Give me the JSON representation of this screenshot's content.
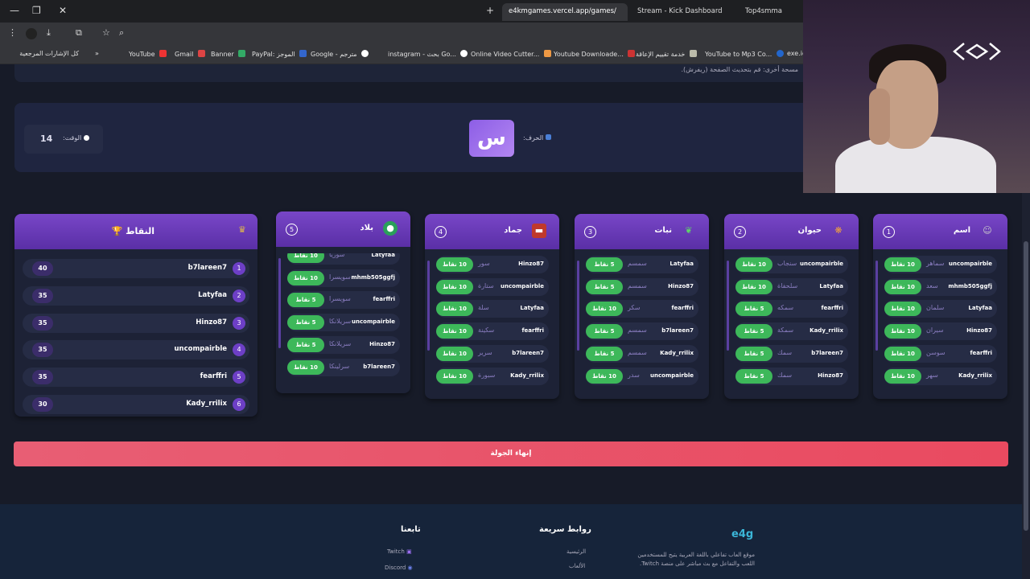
{
  "browser": {
    "tabs": [
      {
        "label": "e4kmgames.vercel.app/games/",
        "active": true
      },
      {
        "label": "Stream - Kick Dashboard",
        "active": false
      },
      {
        "label": "Top4smma",
        "active": false
      }
    ],
    "new_tab": "+",
    "bookmarks": [
      "كل الإشارات المرجعية",
      "YouTube",
      "Gmail",
      "Banner",
      "PayPal: الموجز",
      "Google - مترجم",
      "instagram - بحث Go...",
      "Online Video Cutter...",
      "Youtube Downloade...",
      "خدمة تقييم الإعاقة",
      "YouTube to Mp3 Co...",
      "exe.io"
    ],
    "bookmarks_more": "»"
  },
  "page": {
    "instructions": "مسحة أخرى: قم بتحديث الصفحة (ريفرش).",
    "letter": {
      "label": "الحرف:",
      "value": "س"
    },
    "timer": {
      "label": "الوقت:",
      "value": "14"
    },
    "end_round": "إنهاء الجولة"
  },
  "categories": [
    {
      "num": "1",
      "title": "اسم",
      "icon": "person-icon",
      "rows": [
        {
          "pts": "10 نقاط",
          "ans": "سماهر",
          "who": "uncompairble"
        },
        {
          "pts": "10 نقاط",
          "ans": "سعد",
          "who": "mhmb505ggfj"
        },
        {
          "pts": "10 نقاط",
          "ans": "سلمان",
          "who": "Latyfaa"
        },
        {
          "pts": "10 نقاط",
          "ans": "سيران",
          "who": "Hinzo87"
        },
        {
          "pts": "10 نقاط",
          "ans": "سوسن",
          "who": "fearffri"
        },
        {
          "pts": "10 نقاط",
          "ans": "سهر",
          "who": "Kady_rrilix"
        }
      ]
    },
    {
      "num": "2",
      "title": "حيوان",
      "icon": "paw-icon",
      "rows": [
        {
          "pts": "10 نقاط",
          "ans": "سنجاب",
          "who": "uncompairble"
        },
        {
          "pts": "10 نقاط",
          "ans": "سلحفاة",
          "who": "Latyfaa"
        },
        {
          "pts": "5 نقاط",
          "ans": "سمكه",
          "who": "fearffri"
        },
        {
          "pts": "5 نقاط",
          "ans": "سمكة",
          "who": "Kady_rrilix"
        },
        {
          "pts": "5 نقاط",
          "ans": "سمك",
          "who": "b7lareen7"
        },
        {
          "pts": "5 نقاط",
          "ans": "سمك",
          "who": "Hinzo87"
        }
      ]
    },
    {
      "num": "3",
      "title": "نبات",
      "icon": "leaf-icon",
      "rows": [
        {
          "pts": "5 نقاط",
          "ans": "سمسم",
          "who": "Latyfaa"
        },
        {
          "pts": "5 نقاط",
          "ans": "سمسم",
          "who": "Hinzo87"
        },
        {
          "pts": "10 نقاط",
          "ans": "سكر",
          "who": "fearffri"
        },
        {
          "pts": "5 نقاط",
          "ans": "سمسم",
          "who": "b7lareen7"
        },
        {
          "pts": "5 نقاط",
          "ans": "سمسم",
          "who": "Kady_rrilix"
        },
        {
          "pts": "10 نقاط",
          "ans": "سدر",
          "who": "uncompairble"
        }
      ]
    },
    {
      "num": "4",
      "title": "جماد",
      "icon": "toolbox-icon",
      "rows": [
        {
          "pts": "10 نقاط",
          "ans": "سور",
          "who": "Hinzo87"
        },
        {
          "pts": "10 نقاط",
          "ans": "ستارة",
          "who": "uncompairble"
        },
        {
          "pts": "10 نقاط",
          "ans": "سلة",
          "who": "Latyfaa"
        },
        {
          "pts": "10 نقاط",
          "ans": "سكينة",
          "who": "fearffri"
        },
        {
          "pts": "10 نقاط",
          "ans": "سرير",
          "who": "b7lareen7"
        },
        {
          "pts": "10 نقاط",
          "ans": "سبورة",
          "who": "Kady_rrilix"
        }
      ]
    },
    {
      "num": "5",
      "title": "بلاد",
      "icon": "globe-icon",
      "rows": [
        {
          "pts": "10 نقاط",
          "ans": "سوريا",
          "who": "Latyfaa"
        },
        {
          "pts": "10 نقاط",
          "ans": "سويسرا",
          "who": "mhmb505ggfj"
        },
        {
          "pts": "5 نقاط",
          "ans": "سويسرا",
          "who": "fearffri"
        },
        {
          "pts": "5 نقاط",
          "ans": "سريلانكا",
          "who": "uncompairble"
        },
        {
          "pts": "5 نقاط",
          "ans": "سريلانكا",
          "who": "Hinzo87"
        },
        {
          "pts": "10 نقاط",
          "ans": "سرلينكا",
          "who": "b7lareen7"
        }
      ]
    }
  ],
  "scoreboard": {
    "title": "النقاط",
    "rows": [
      {
        "rank": "1",
        "name": "b7lareen7",
        "pts": "40"
      },
      {
        "rank": "2",
        "name": "Latyfaa",
        "pts": "35"
      },
      {
        "rank": "3",
        "name": "Hinzo87",
        "pts": "35"
      },
      {
        "rank": "4",
        "name": "uncompairble",
        "pts": "35"
      },
      {
        "rank": "5",
        "name": "fearffri",
        "pts": "35"
      },
      {
        "rank": "6",
        "name": "Kady_rrilix",
        "pts": "30"
      }
    ]
  },
  "footer": {
    "brand": "e4g",
    "about": "موقع العاب تفاعلي باللغة العربية يتيح للمستخدمين اللعب والتفاعل مع بث مباشر على منصة Twitch.",
    "quick_title": "روابط سريعة",
    "quick_links": [
      "الرئيسية",
      "الألعاب"
    ],
    "follow_title": "تابعنا",
    "follow_links": [
      "Twitch",
      "Discord"
    ]
  }
}
